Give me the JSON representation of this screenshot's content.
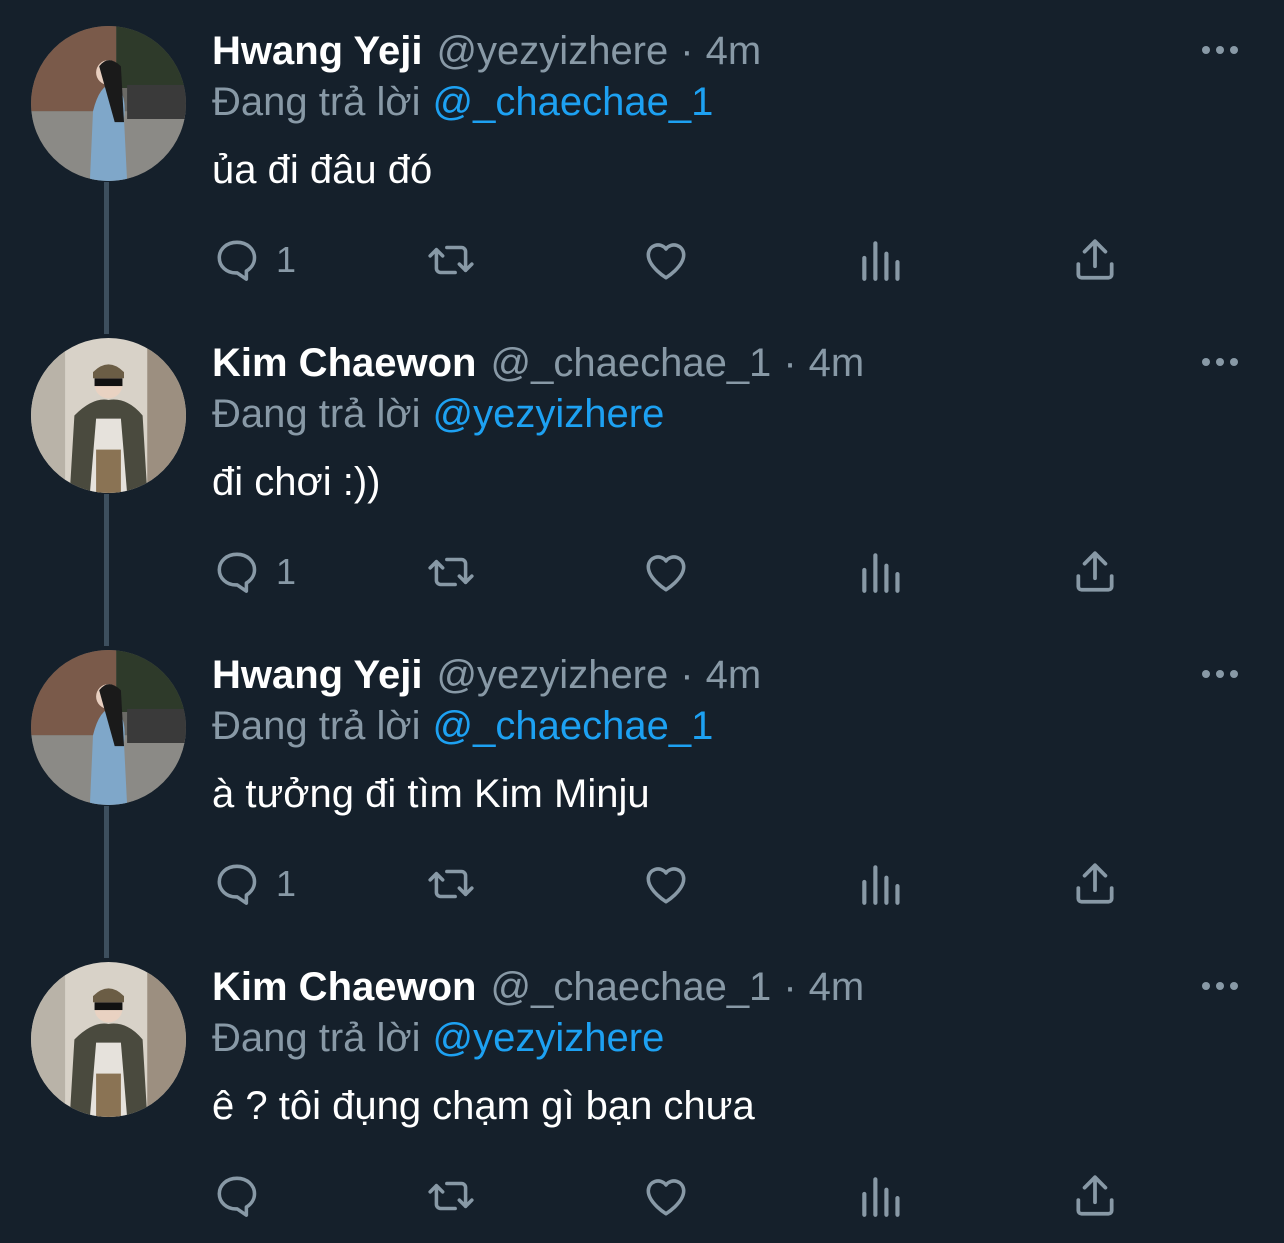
{
  "tweets": [
    {
      "name": "Hwang Yeji",
      "handle": "@yezyizhere",
      "time": "4m",
      "reply_prefix": "Đang trả lời",
      "reply_to": "@_chaechae_1",
      "text": "ủa đi đâu đó",
      "reply_count": "1"
    },
    {
      "name": "Kim Chaewon",
      "handle": "@_chaechae_1",
      "time": "4m",
      "reply_prefix": "Đang trả lời",
      "reply_to": "@yezyizhere",
      "text": "đi chơi :))",
      "reply_count": "1"
    },
    {
      "name": "Hwang Yeji",
      "handle": "@yezyizhere",
      "time": "4m",
      "reply_prefix": "Đang trả lời",
      "reply_to": "@_chaechae_1",
      "text": "à tưởng đi tìm Kim Minju",
      "reply_count": "1"
    },
    {
      "name": "Kim Chaewon",
      "handle": "@_chaechae_1",
      "time": "4m",
      "reply_prefix": "Đang trả lời",
      "reply_to": "@yezyizhere",
      "text": "ê ? tôi đụng chạm gì bạn chưa",
      "reply_count": ""
    }
  ],
  "icons": {
    "reply": "speech-bubble-icon",
    "retweet": "retweet-icon",
    "like": "heart-icon",
    "views": "bar-chart-icon",
    "share": "share-icon",
    "more": "more-dots-icon"
  },
  "colors": {
    "background": "#15202b",
    "text": "#ffffff",
    "muted": "#8899a6",
    "link": "#1da1f2",
    "thread_line": "#3d4f5e"
  }
}
